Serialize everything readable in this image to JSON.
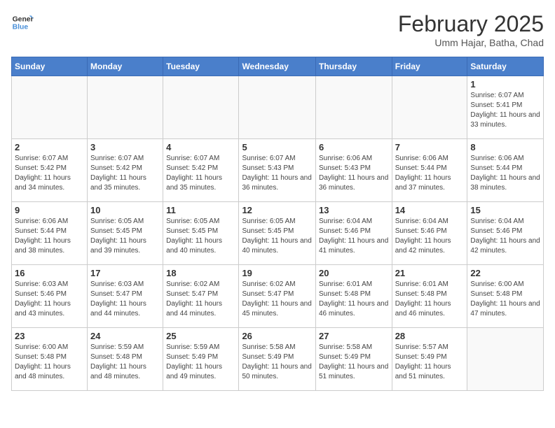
{
  "logo": {
    "line1": "General",
    "line2": "Blue"
  },
  "title": "February 2025",
  "subtitle": "Umm Hajar, Batha, Chad",
  "weekdays": [
    "Sunday",
    "Monday",
    "Tuesday",
    "Wednesday",
    "Thursday",
    "Friday",
    "Saturday"
  ],
  "weeks": [
    [
      {
        "day": "",
        "info": ""
      },
      {
        "day": "",
        "info": ""
      },
      {
        "day": "",
        "info": ""
      },
      {
        "day": "",
        "info": ""
      },
      {
        "day": "",
        "info": ""
      },
      {
        "day": "",
        "info": ""
      },
      {
        "day": "1",
        "info": "Sunrise: 6:07 AM\nSunset: 5:41 PM\nDaylight: 11 hours and 33 minutes."
      }
    ],
    [
      {
        "day": "2",
        "info": "Sunrise: 6:07 AM\nSunset: 5:42 PM\nDaylight: 11 hours and 34 minutes."
      },
      {
        "day": "3",
        "info": "Sunrise: 6:07 AM\nSunset: 5:42 PM\nDaylight: 11 hours and 35 minutes."
      },
      {
        "day": "4",
        "info": "Sunrise: 6:07 AM\nSunset: 5:42 PM\nDaylight: 11 hours and 35 minutes."
      },
      {
        "day": "5",
        "info": "Sunrise: 6:07 AM\nSunset: 5:43 PM\nDaylight: 11 hours and 36 minutes."
      },
      {
        "day": "6",
        "info": "Sunrise: 6:06 AM\nSunset: 5:43 PM\nDaylight: 11 hours and 36 minutes."
      },
      {
        "day": "7",
        "info": "Sunrise: 6:06 AM\nSunset: 5:44 PM\nDaylight: 11 hours and 37 minutes."
      },
      {
        "day": "8",
        "info": "Sunrise: 6:06 AM\nSunset: 5:44 PM\nDaylight: 11 hours and 38 minutes."
      }
    ],
    [
      {
        "day": "9",
        "info": "Sunrise: 6:06 AM\nSunset: 5:44 PM\nDaylight: 11 hours and 38 minutes."
      },
      {
        "day": "10",
        "info": "Sunrise: 6:05 AM\nSunset: 5:45 PM\nDaylight: 11 hours and 39 minutes."
      },
      {
        "day": "11",
        "info": "Sunrise: 6:05 AM\nSunset: 5:45 PM\nDaylight: 11 hours and 40 minutes."
      },
      {
        "day": "12",
        "info": "Sunrise: 6:05 AM\nSunset: 5:45 PM\nDaylight: 11 hours and 40 minutes."
      },
      {
        "day": "13",
        "info": "Sunrise: 6:04 AM\nSunset: 5:46 PM\nDaylight: 11 hours and 41 minutes."
      },
      {
        "day": "14",
        "info": "Sunrise: 6:04 AM\nSunset: 5:46 PM\nDaylight: 11 hours and 42 minutes."
      },
      {
        "day": "15",
        "info": "Sunrise: 6:04 AM\nSunset: 5:46 PM\nDaylight: 11 hours and 42 minutes."
      }
    ],
    [
      {
        "day": "16",
        "info": "Sunrise: 6:03 AM\nSunset: 5:46 PM\nDaylight: 11 hours and 43 minutes."
      },
      {
        "day": "17",
        "info": "Sunrise: 6:03 AM\nSunset: 5:47 PM\nDaylight: 11 hours and 44 minutes."
      },
      {
        "day": "18",
        "info": "Sunrise: 6:02 AM\nSunset: 5:47 PM\nDaylight: 11 hours and 44 minutes."
      },
      {
        "day": "19",
        "info": "Sunrise: 6:02 AM\nSunset: 5:47 PM\nDaylight: 11 hours and 45 minutes."
      },
      {
        "day": "20",
        "info": "Sunrise: 6:01 AM\nSunset: 5:48 PM\nDaylight: 11 hours and 46 minutes."
      },
      {
        "day": "21",
        "info": "Sunrise: 6:01 AM\nSunset: 5:48 PM\nDaylight: 11 hours and 46 minutes."
      },
      {
        "day": "22",
        "info": "Sunrise: 6:00 AM\nSunset: 5:48 PM\nDaylight: 11 hours and 47 minutes."
      }
    ],
    [
      {
        "day": "23",
        "info": "Sunrise: 6:00 AM\nSunset: 5:48 PM\nDaylight: 11 hours and 48 minutes."
      },
      {
        "day": "24",
        "info": "Sunrise: 5:59 AM\nSunset: 5:48 PM\nDaylight: 11 hours and 48 minutes."
      },
      {
        "day": "25",
        "info": "Sunrise: 5:59 AM\nSunset: 5:49 PM\nDaylight: 11 hours and 49 minutes."
      },
      {
        "day": "26",
        "info": "Sunrise: 5:58 AM\nSunset: 5:49 PM\nDaylight: 11 hours and 50 minutes."
      },
      {
        "day": "27",
        "info": "Sunrise: 5:58 AM\nSunset: 5:49 PM\nDaylight: 11 hours and 51 minutes."
      },
      {
        "day": "28",
        "info": "Sunrise: 5:57 AM\nSunset: 5:49 PM\nDaylight: 11 hours and 51 minutes."
      },
      {
        "day": "",
        "info": ""
      }
    ]
  ]
}
